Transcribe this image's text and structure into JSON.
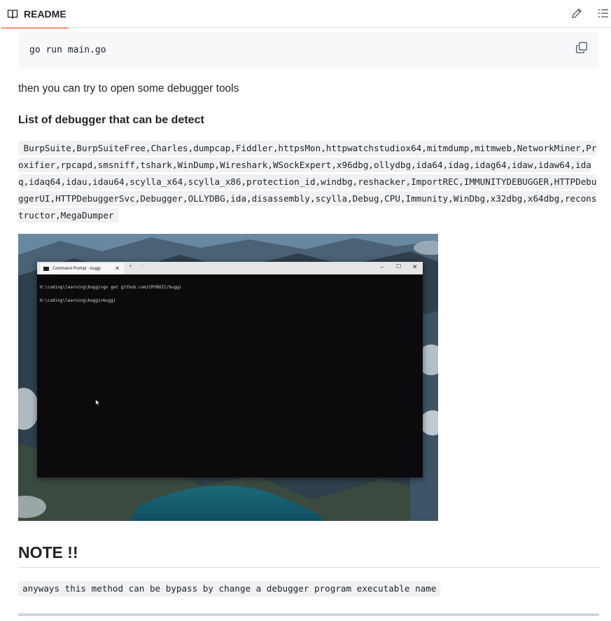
{
  "header": {
    "tab_label": "README",
    "icons": [
      "book-icon",
      "pencil-icon",
      "list-icon"
    ]
  },
  "code_block": {
    "code": "go run main.go",
    "copy_icon": "copy-icon"
  },
  "paragraph": "then you can try to open some debugger tools",
  "debugger_heading": "List of debugger that can be detect",
  "debugger_list": "BurpSuite,BurpSuiteFree,Charles,dumpcap,Fiddler,httpsMon,httpwatchstudiox64,mitmdump,mitmweb,NetworkMiner,Proxifier,rpcapd,smsniff,tshark,WinDump,Wireshark,WSockExpert,x96dbg,ollydbg,ida64,idag,idag64,idaw,idaw64,idaq,idaq64,idau,idau64,scylla_x64,scylla_x86,protection_id,windbg,reshacker,ImportREC,IMMUNITYDEBUGGER,HTTPDebuggerUI,HTTPDebuggerSvc,Debugger,OLLYDBG,ida,disassembly,scylla,Debug,CPU,Immunity,WinDbg,x32dbg,x64dbg,reconstructor,MegaDumper",
  "screenshot": {
    "window_tab_title": "Command Prompt - buggi",
    "lines": [
      "H:\\coding\\learning\\buggi>go get github.com/CRYBOII/buggi",
      "H:\\coding\\learning\\buggi>buggi"
    ]
  },
  "note_heading": "NOTE !!",
  "note_code": "anyways this method can be bypass by change a debugger program executable name",
  "colors": {
    "tab_underline": "#fd8c73",
    "code_bg": "#f6f8fa",
    "text": "#1f2328"
  }
}
